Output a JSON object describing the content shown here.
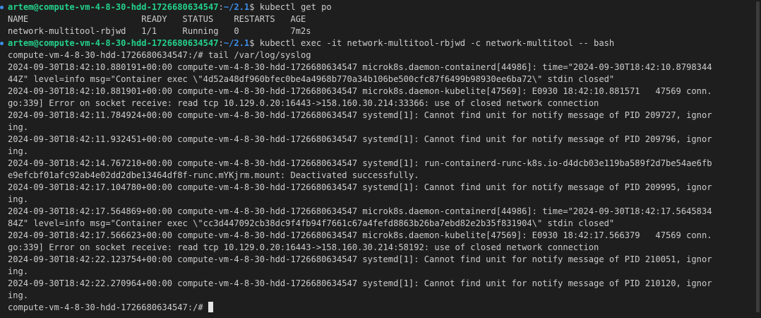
{
  "prompt": {
    "user_host": "artem@compute-vm-4-8-30-hdd-1726680634547",
    "sep": ":",
    "path": "~/2.1",
    "dollar": "$ "
  },
  "commands": {
    "get_po": "kubectl get po",
    "exec": "kubectl exec -it network-multitool-rbjwd -c network-multitool -- bash"
  },
  "pods_table": {
    "header": "NAME                      READY   STATUS    RESTARTS   AGE",
    "row": "network-multitool-rbjwd   1/1     Running   0          7m2s"
  },
  "container_prompt_tail": "compute-vm-4-8-30-hdd-1726680634547:/# tail /var/log/syslog",
  "syslog_lines": [
    "2024-09-30T18:42:10.880191+00:00 compute-vm-4-8-30-hdd-1726680634547 microk8s.daemon-containerd[44986]: time=\"2024-09-30T18:42:10.8798344",
    "44Z\" level=info msg=\"Container exec \\\"4d52a48df960bfec0be4a4968b770a34b106be500cfc87f6499b98930ee6ba72\\\" stdin closed\"",
    "2024-09-30T18:42:10.881901+00:00 compute-vm-4-8-30-hdd-1726680634547 microk8s.daemon-kubelite[47569]: E0930 18:42:10.881571   47569 conn.",
    "go:339] Error on socket receive: read tcp 10.129.0.20:16443->158.160.30.214:33366: use of closed network connection",
    "2024-09-30T18:42:11.784924+00:00 compute-vm-4-8-30-hdd-1726680634547 systemd[1]: Cannot find unit for notify message of PID 209727, ignor",
    "ing.",
    "2024-09-30T18:42:11.932451+00:00 compute-vm-4-8-30-hdd-1726680634547 systemd[1]: Cannot find unit for notify message of PID 209796, ignor",
    "ing.",
    "2024-09-30T18:42:14.767210+00:00 compute-vm-4-8-30-hdd-1726680634547 systemd[1]: run-containerd-runc-k8s.io-d4dcb03e119ba589f2d7be54ae6fb",
    "e9efcbf01afc92ab4e02dd2dbe13464df8f-runc.mYKjrm.mount: Deactivated successfully.",
    "2024-09-30T18:42:17.104780+00:00 compute-vm-4-8-30-hdd-1726680634547 systemd[1]: Cannot find unit for notify message of PID 209995, ignor",
    "ing.",
    "2024-09-30T18:42:17.564869+00:00 compute-vm-4-8-30-hdd-1726680634547 microk8s.daemon-containerd[44986]: time=\"2024-09-30T18:42:17.5645834",
    "84Z\" level=info msg=\"Container exec \\\"cc3d447092cb38dc9f4fb94f7661c67a4fefd8863b26ba7ebd82e2b35f831904\\\" stdin closed\"",
    "2024-09-30T18:42:17.566623+00:00 compute-vm-4-8-30-hdd-1726680634547 microk8s.daemon-kubelite[47569]: E0930 18:42:17.566379   47569 conn.",
    "go:339] Error on socket receive: read tcp 10.129.0.20:16443->158.160.30.214:58192: use of closed network connection",
    "2024-09-30T18:42:22.123754+00:00 compute-vm-4-8-30-hdd-1726680634547 systemd[1]: Cannot find unit for notify message of PID 210051, ignor",
    "ing.",
    "2024-09-30T18:42:22.270964+00:00 compute-vm-4-8-30-hdd-1726680634547 systemd[1]: Cannot find unit for notify message of PID 210120, ignor",
    "ing."
  ],
  "final_prompt": "compute-vm-4-8-30-hdd-1726680634547:/# ",
  "colors": {
    "background": "#1e1e1e",
    "text": "#cccccc",
    "user_host": "#23d18b",
    "path": "#3b8eea"
  }
}
